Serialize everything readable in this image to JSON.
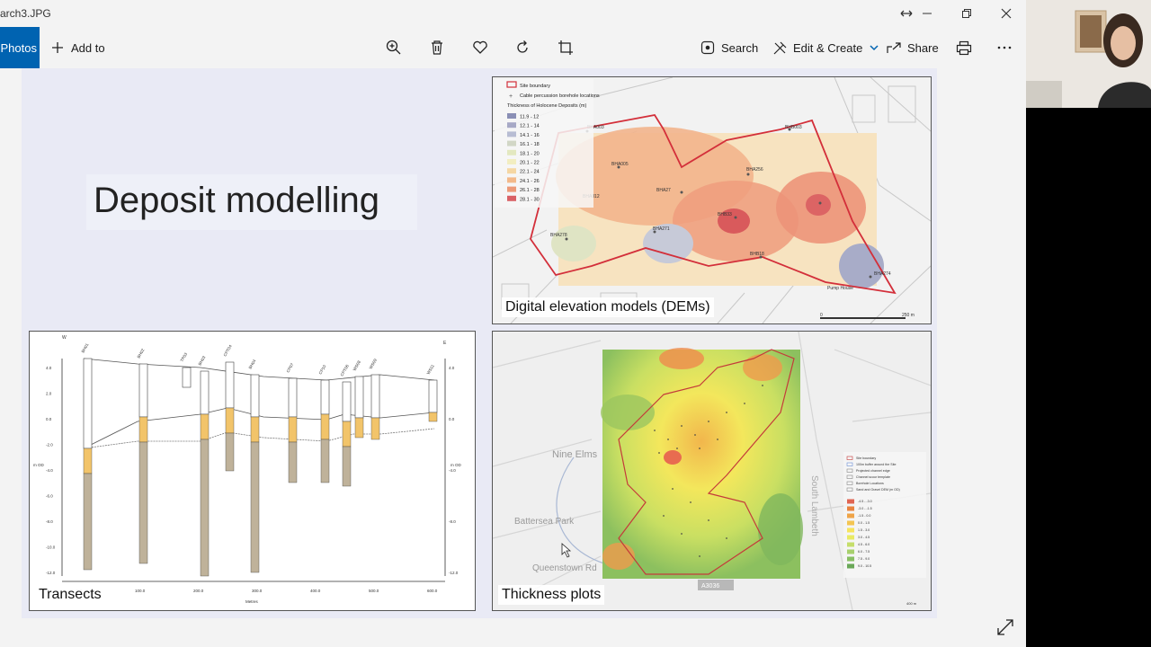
{
  "window": {
    "file_name": "arch3.JPG",
    "resize_icon": "resize-arrows-icon",
    "minimize_icon": "minimize-icon",
    "restore_icon": "restore-icon",
    "close_icon": "close-icon"
  },
  "toolbar": {
    "all_photos_label": "Photos",
    "add_to_label": "Add to",
    "search_label": "Search",
    "edit_create_label": "Edit & Create",
    "share_label": "Share",
    "accent_color": "#0063b1"
  },
  "slide": {
    "title": "Deposit modelling",
    "panels": {
      "dem_caption": "Digital elevation models (DEMs)",
      "transects_caption": "Transects",
      "thickness_caption": "Thickness plots"
    },
    "dem_legend": {
      "entries": [
        "Site boundary",
        "Cable percussion borehole locations",
        "Thickness of Holocene Deposits (m)"
      ],
      "ranges": [
        "11.9 - 12",
        "12.1 - 14",
        "14.1 - 16",
        "16.1 - 18",
        "18.1 - 20",
        "20.1 - 22",
        "22.1 - 24",
        "24.1 - 26",
        "26.1 - 28",
        "28.1 - 30"
      ],
      "range_colors": [
        "#8a8fb5",
        "#a7a9c6",
        "#b8bdd3",
        "#d2d7c6",
        "#e3e8c0",
        "#f2eec1",
        "#f5d7a3",
        "#f3b98a",
        "#ec9a78",
        "#d96166"
      ],
      "labels": [
        "BHA003",
        "BHA005",
        "BHA012",
        "BHA256",
        "BHA27",
        "BHA271",
        "BHB003",
        "BHB33",
        "BHA278",
        "BHB18",
        "BHA274",
        "Pump House",
        "250 m",
        "0"
      ]
    },
    "transects": {
      "axis_label": "m OD",
      "x_axis_label": "Metres",
      "x_ticks": [
        "0.0",
        "100.0",
        "200.0",
        "300.0",
        "400.0",
        "500.0",
        "600.0"
      ],
      "y_ticks_left": [
        "4.0",
        "2.0",
        "0.0",
        "-2.0",
        "-4.0",
        "-6.0",
        "-8.0",
        "-10.0",
        "-12.0"
      ],
      "y_ticks_right": [
        "4.0",
        "0.0",
        "-4.0",
        "-8.0",
        "-12.0"
      ],
      "boreholes": [
        "BH01",
        "BH02",
        "TP03",
        "BH03",
        "CPT04",
        "BH04",
        "CP07",
        "CP10",
        "CPT06",
        "WS08",
        "WS09",
        "WS11"
      ],
      "end_labels": [
        "W",
        "E"
      ]
    },
    "thickness": {
      "places": [
        "Nine Elms",
        "Battersea Park",
        "Queenstown Rd",
        "South Lambeth",
        "A3036"
      ],
      "legend": [
        "Site boundary",
        "100m buffer around the Site",
        "Projected channel edge",
        "Channel scour template",
        "Borehole Locations",
        "Sand and Gravel DEM (m OD)"
      ],
      "legend_ranges": [
        "-4.5 - -3.0",
        "-3.0 - -1.5",
        "-1.5 - 0.0",
        "0.0 - 1.5",
        "1.5 - 3.0",
        "3.0 - 4.5",
        "4.5 - 6.0",
        "6.0 - 7.5",
        "7.5 - 9.0",
        "9.0 - 10.5"
      ],
      "legend_colors": [
        "#e06552",
        "#e8833f",
        "#efa448",
        "#f4c552",
        "#f6e45d",
        "#e9ea63",
        "#c5de6b",
        "#a7d06d",
        "#88bf63",
        "#6aa858"
      ],
      "scale": "400 m"
    }
  }
}
